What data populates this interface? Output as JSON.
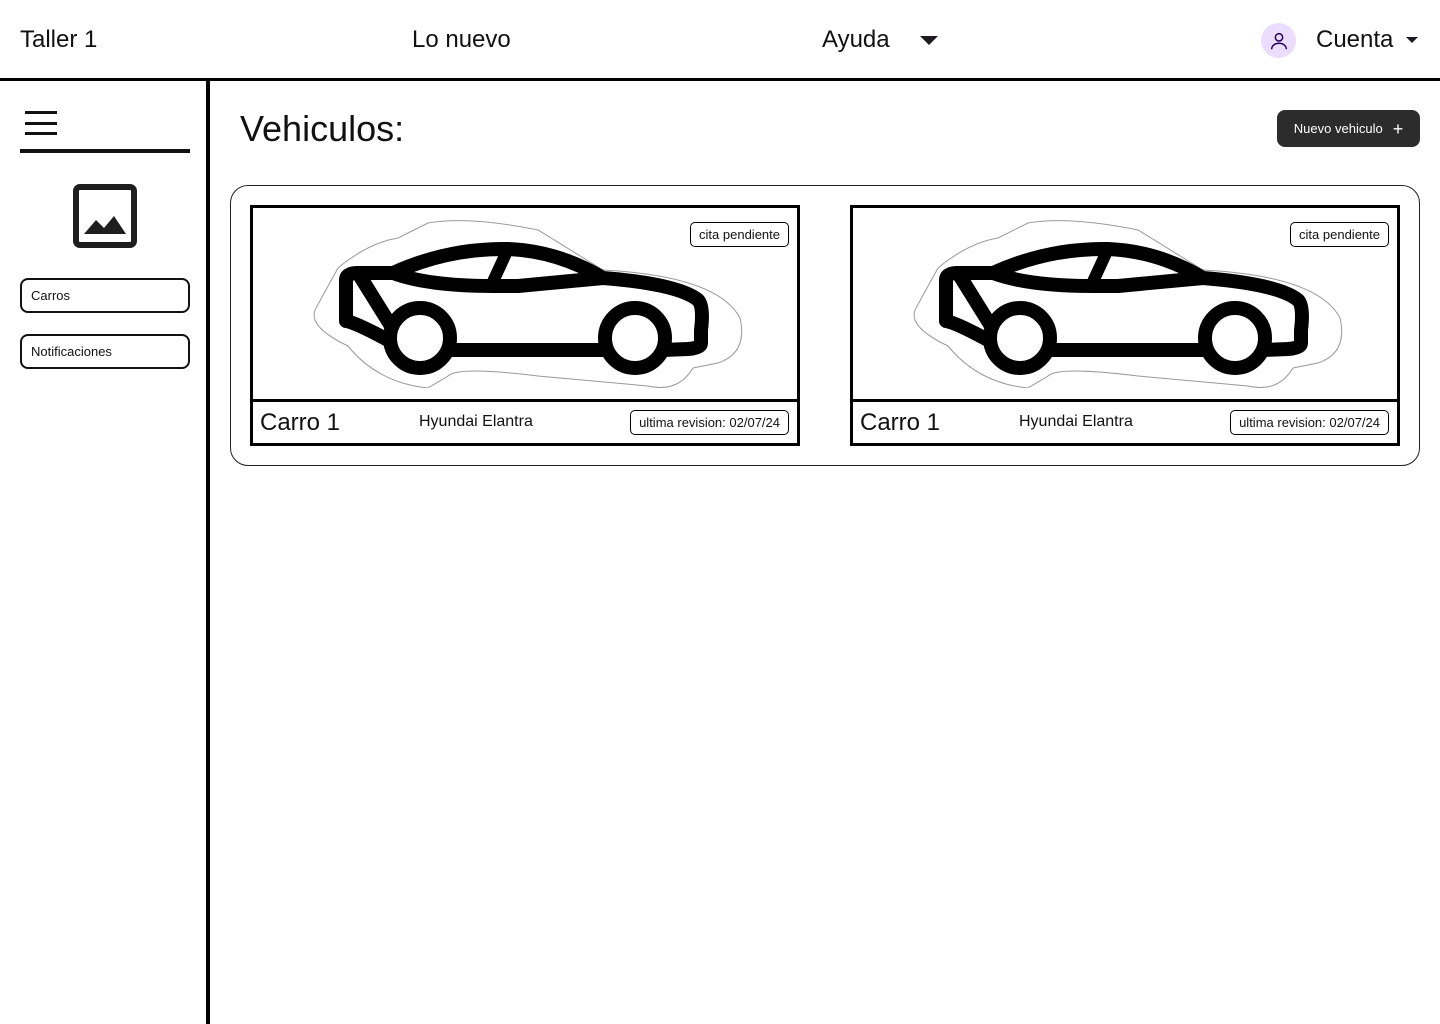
{
  "header": {
    "brand": "Taller 1",
    "nav_new": "Lo nuevo",
    "nav_help": "Ayuda",
    "account": "Cuenta",
    "icons": {
      "avatar": "user-icon",
      "help_dropdown": "caret-down-icon",
      "account_dropdown": "caret-down-icon"
    }
  },
  "sidebar": {
    "menu_icon": "hamburger-icon",
    "logo_icon": "image-icon",
    "items": [
      {
        "label": "Carros"
      },
      {
        "label": "Notificaciones"
      }
    ]
  },
  "main": {
    "title": "Vehiculos:",
    "new_button": {
      "label": "Nuevo vehiculo",
      "icon": "plus-icon"
    },
    "vehicles": [
      {
        "name": "Carro 1",
        "model": "Hyundai Elantra",
        "status": "cita pendiente",
        "revision": "ultima revision: 02/07/24",
        "icon": "car-icon"
      },
      {
        "name": "Carro 1",
        "model": "Hyundai Elantra",
        "status": "cita pendiente",
        "revision": "ultima revision: 02/07/24",
        "icon": "car-icon"
      }
    ]
  },
  "colors": {
    "primary_button": "#2c2c2c",
    "avatar_bg": "#eaddff",
    "border": "#000000"
  }
}
